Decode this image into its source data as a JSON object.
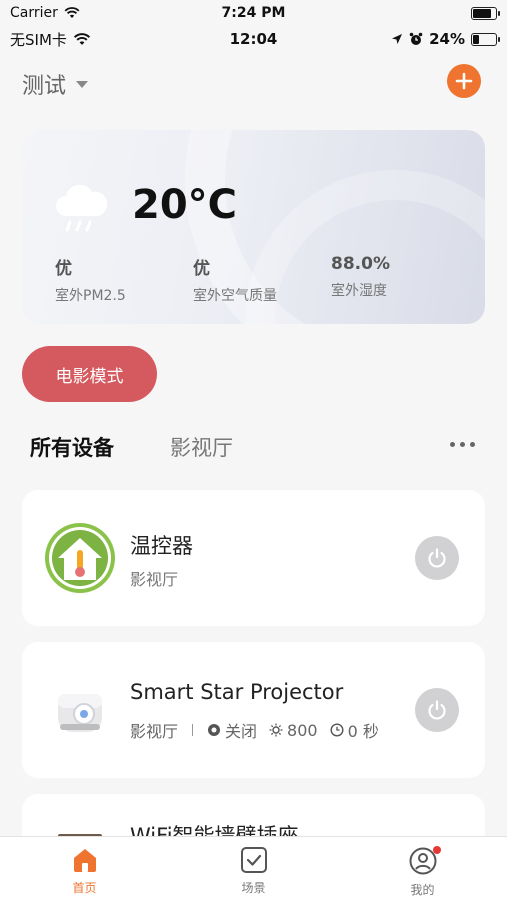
{
  "sim_status": {
    "carrier": "Carrier",
    "time": "7:24 PM"
  },
  "phone_status": {
    "carrier": "无SIM卡",
    "time": "12:04",
    "battery": "24%"
  },
  "header": {
    "home_name": "测试"
  },
  "weather": {
    "temperature": "20°C",
    "metrics": [
      {
        "value": "优",
        "label": "室外PM2.5"
      },
      {
        "value": "优",
        "label": "室外空气质量"
      },
      {
        "value": "88.0%",
        "label": "室外湿度"
      }
    ]
  },
  "scene_button": {
    "label": "电影模式"
  },
  "tabs": {
    "active": "所有设备",
    "inactive": "影视厅"
  },
  "devices": [
    {
      "name": "温控器",
      "room": "影视厅",
      "icon": "thermometer-house-icon"
    },
    {
      "name": "Smart Star Projector",
      "room": "影视厅",
      "status": "关闭",
      "brightness": "800",
      "timer": "0 秒",
      "icon": "projector-icon"
    },
    {
      "name": "WiFi智能墙壁插座",
      "icon": "socket-icon"
    }
  ],
  "bottom_tabs": [
    {
      "label": "首页",
      "icon": "home-icon"
    },
    {
      "label": "场景",
      "icon": "checkbox-icon"
    },
    {
      "label": "我的",
      "icon": "user-icon"
    }
  ],
  "colors": {
    "accent": "#ee7430",
    "scene": "#d45a5f",
    "power": "#d1d1d4"
  }
}
